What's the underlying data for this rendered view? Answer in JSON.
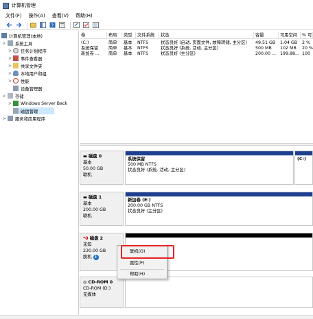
{
  "window": {
    "title": "计算机管理"
  },
  "menu": [
    "文件(F)",
    "操作(A)",
    "查看(V)",
    "帮助(H)"
  ],
  "toolbar_icons": [
    "back-icon",
    "forward-icon",
    "up-icon",
    "show-hide-tree-icon",
    "help-icon",
    "properties-icon",
    "export-icon",
    "checklist-icon",
    "view-icon"
  ],
  "tree": {
    "root": "计算机管理(本地)",
    "system_tools": "系统工具",
    "task_scheduler": "任务计划程序",
    "event_viewer": "事件查看器",
    "shared_folders": "共享文件夹",
    "local_users": "本地用户和组",
    "performance": "性能",
    "device_manager": "设备管理器",
    "storage": "存储",
    "wsb": "Windows Server Back",
    "disk_management": "磁盘管理",
    "services": "服务和应用程序"
  },
  "volume_headers": [
    "卷",
    "布局",
    "类型",
    "文件系统",
    "状态",
    "容量",
    "可用空间",
    "% 可"
  ],
  "volumes": [
    [
      "(C:)",
      "简单",
      "基本",
      "NTFS",
      "状态良好 (启动, 页面文件, 故障转储, 主分区)",
      "49.51 GB",
      "1.04 GB",
      "2 %"
    ],
    [
      "系统保留",
      "简单",
      "基本",
      "NTFS",
      "状态良好 (系统, 活动, 主分区)",
      "500 MB",
      "102 MB",
      "20 %"
    ],
    [
      "新加卷 ...",
      "简单",
      "基本",
      "NTFS",
      "状态良好 (主分区)",
      "200.00 ...",
      "199.88...",
      "100"
    ]
  ],
  "disks": [
    {
      "name": "磁盘 0",
      "type": "基本",
      "size": "50.00 GB",
      "status": "联机",
      "parts": [
        {
          "name": "系统保留",
          "line1": "500 MB NTFS",
          "line2": "状态良好 (系统, 活动, 主分区)"
        },
        {
          "name": "(C:)",
          "line1": "",
          "line2": ""
        }
      ]
    },
    {
      "name": "磁盘 1",
      "type": "基本",
      "size": "200.00 GB",
      "status": "联机",
      "parts": [
        {
          "name": "新加卷 (E:)",
          "line1": "200.00 GB NTFS",
          "line2": "状态良好 (主分区)"
        }
      ]
    },
    {
      "name": "磁盘 2",
      "type": "未知",
      "size": "230.00 GB",
      "status": "脱机",
      "parts": []
    },
    {
      "name": "CD-ROM 0",
      "type": "CD-ROM (D:)",
      "size": "",
      "status": "无媒体",
      "parts": []
    }
  ],
  "context_menu": {
    "online": "联机(O)",
    "properties": "属性(P)",
    "help": "帮助(H)"
  },
  "colors": {
    "primary_bar": "#1c3f8f",
    "unallocated_bar": "#000000",
    "highlight": "#e52222",
    "selection": "#cce8ff"
  }
}
